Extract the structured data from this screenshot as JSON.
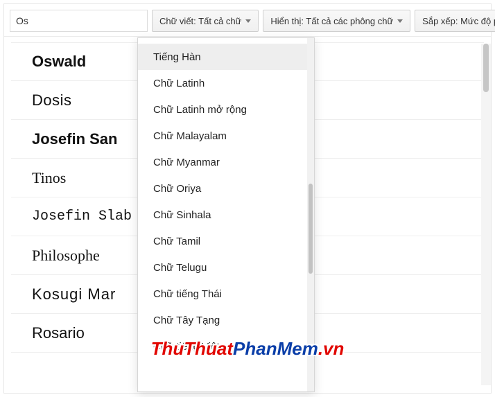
{
  "search": {
    "value": "Os"
  },
  "toolbar": {
    "script_dropdown_label": "Chữ viết: Tất cả chữ",
    "display_dropdown_label": "Hiển thị: Tất cả các phông chữ",
    "sort_dropdown_label": "Sắp xếp: Mức độ phổ biến"
  },
  "fonts": [
    {
      "name": "Oswald",
      "css": "font-oswald"
    },
    {
      "name": "Dosis",
      "css": "font-dosis"
    },
    {
      "name": "Josefin San",
      "css": "font-josefinsans"
    },
    {
      "name": "Tinos",
      "css": "font-tinos"
    },
    {
      "name": "Josefin Slab",
      "css": "font-josefinslab"
    },
    {
      "name": "Philosophe",
      "css": "font-philosopher"
    },
    {
      "name": "Kosugi Mar",
      "css": "font-kosugi"
    },
    {
      "name": "Rosario",
      "css": "font-rosario"
    }
  ],
  "script_options": {
    "highlighted_index": 0,
    "items": [
      "Tiếng Hàn",
      "Chữ Latinh",
      "Chữ Latinh mở rộng",
      "Chữ Malayalam",
      "Chữ Myanmar",
      "Chữ Oriya",
      "Chữ Sinhala",
      "Chữ Tamil",
      "Chữ Telugu",
      "Chữ tiếng Thái",
      "Chữ Tây Tạng",
      "Chữ tiếng Việt"
    ]
  },
  "watermark": {
    "seg1": "ThuThuat",
    "seg2": "PhanMem",
    "seg3": ".vn"
  }
}
